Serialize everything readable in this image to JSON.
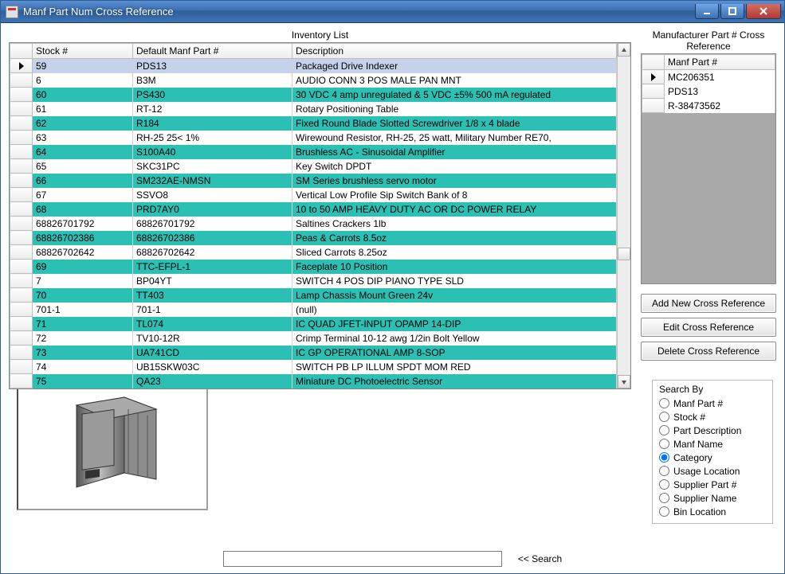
{
  "window": {
    "title": "Manf Part Num Cross Reference"
  },
  "labels": {
    "inventory": "Inventory List",
    "crossref": "Manufacturer Part # Cross Reference"
  },
  "inventory": {
    "columns": [
      "Stock #",
      "Default Manf Part #",
      "Description"
    ],
    "rows": [
      {
        "sel": true,
        "alt": false,
        "c": [
          "59",
          "PDS13",
          "Packaged Drive Indexer"
        ]
      },
      {
        "sel": false,
        "alt": false,
        "c": [
          "6",
          "B3M",
          "AUDIO CONN 3 POS MALE PAN MNT"
        ]
      },
      {
        "sel": false,
        "alt": true,
        "c": [
          "60",
          "PS430",
          "30 VDC 4 amp unregulated & 5 VDC ±5% 500 mA regulated"
        ]
      },
      {
        "sel": false,
        "alt": false,
        "c": [
          "61",
          "RT-12",
          "Rotary Positioning Table"
        ]
      },
      {
        "sel": false,
        "alt": true,
        "c": [
          "62",
          "R184",
          "Fixed Round Blade Slotted Screwdriver 1/8 x 4 blade"
        ]
      },
      {
        "sel": false,
        "alt": false,
        "c": [
          "63",
          "RH-25 25< 1%",
          "Wirewound Resistor, RH-25, 25 watt, Military Number RE70,"
        ]
      },
      {
        "sel": false,
        "alt": true,
        "c": [
          "64",
          "S100A40",
          "Brushless AC - Sinusoidal Amplifier"
        ]
      },
      {
        "sel": false,
        "alt": false,
        "c": [
          "65",
          "SKC31PC",
          "Key Switch DPDT"
        ]
      },
      {
        "sel": false,
        "alt": true,
        "c": [
          "66",
          "SM232AE-NMSN",
          "SM Series brushless servo motor"
        ]
      },
      {
        "sel": false,
        "alt": false,
        "c": [
          "67",
          "SSVO8",
          "Vertical Low Profile Sip Switch Bank of 8"
        ]
      },
      {
        "sel": false,
        "alt": true,
        "c": [
          "68",
          "PRD7AY0",
          "10 to 50 AMP HEAVY DUTY AC OR DC POWER RELAY"
        ]
      },
      {
        "sel": false,
        "alt": false,
        "c": [
          "68826701792",
          "68826701792",
          "Saltines Crackers 1lb"
        ]
      },
      {
        "sel": false,
        "alt": true,
        "c": [
          "68826702386",
          "68826702386",
          "Peas & Carrots 8.5oz"
        ]
      },
      {
        "sel": false,
        "alt": false,
        "c": [
          "68826702642",
          "68826702642",
          "Sliced Carrots 8.25oz"
        ]
      },
      {
        "sel": false,
        "alt": true,
        "c": [
          "69",
          "TTC-EFPL-1",
          "Faceplate 10 Position"
        ]
      },
      {
        "sel": false,
        "alt": false,
        "c": [
          "7",
          "BP04YT",
          "SWITCH 4 POS DIP PIANO TYPE SLD"
        ]
      },
      {
        "sel": false,
        "alt": true,
        "c": [
          "70",
          "TT403",
          "Lamp Chassis Mount Green 24v"
        ]
      },
      {
        "sel": false,
        "alt": false,
        "c": [
          "701-1",
          "701-1",
          "(null)"
        ]
      },
      {
        "sel": false,
        "alt": true,
        "c": [
          "71",
          "TL074",
          "IC QUAD JFET-INPUT OPAMP 14-DIP"
        ]
      },
      {
        "sel": false,
        "alt": false,
        "c": [
          "72",
          "TV10-12R",
          "Crimp Terminal 10-12 awg 1/2in Bolt Yellow"
        ]
      },
      {
        "sel": false,
        "alt": true,
        "c": [
          "73",
          "UA741CD",
          "IC GP OPERATIONAL AMP 8-SOP"
        ]
      },
      {
        "sel": false,
        "alt": false,
        "c": [
          "74",
          "UB15SKW03C",
          "SWITCH PB LP ILLUM SPDT MOM RED"
        ]
      },
      {
        "sel": false,
        "alt": true,
        "c": [
          "75",
          "QA23",
          "Miniature DC Photoelectric Sensor"
        ]
      }
    ]
  },
  "crossref": {
    "column": "Manf Part #",
    "rows": [
      "MC206351",
      "PDS13",
      "R-38473562"
    ]
  },
  "buttons": {
    "add": "Add New Cross Reference",
    "edit": "Edit Cross Reference",
    "del": "Delete Cross Reference"
  },
  "searchBy": {
    "legend": "Search By",
    "options": [
      {
        "label": "Manf Part #",
        "checked": false
      },
      {
        "label": "Stock #",
        "checked": false
      },
      {
        "label": "Part Description",
        "checked": false
      },
      {
        "label": "Manf Name",
        "checked": false
      },
      {
        "label": "Category",
        "checked": true
      },
      {
        "label": "Usage Location",
        "checked": false
      },
      {
        "label": "Supplier Part #",
        "checked": false
      },
      {
        "label": "Supplier Name",
        "checked": false
      },
      {
        "label": "Bin Location",
        "checked": false
      }
    ]
  },
  "search": {
    "label": "<< Search",
    "value": ""
  }
}
